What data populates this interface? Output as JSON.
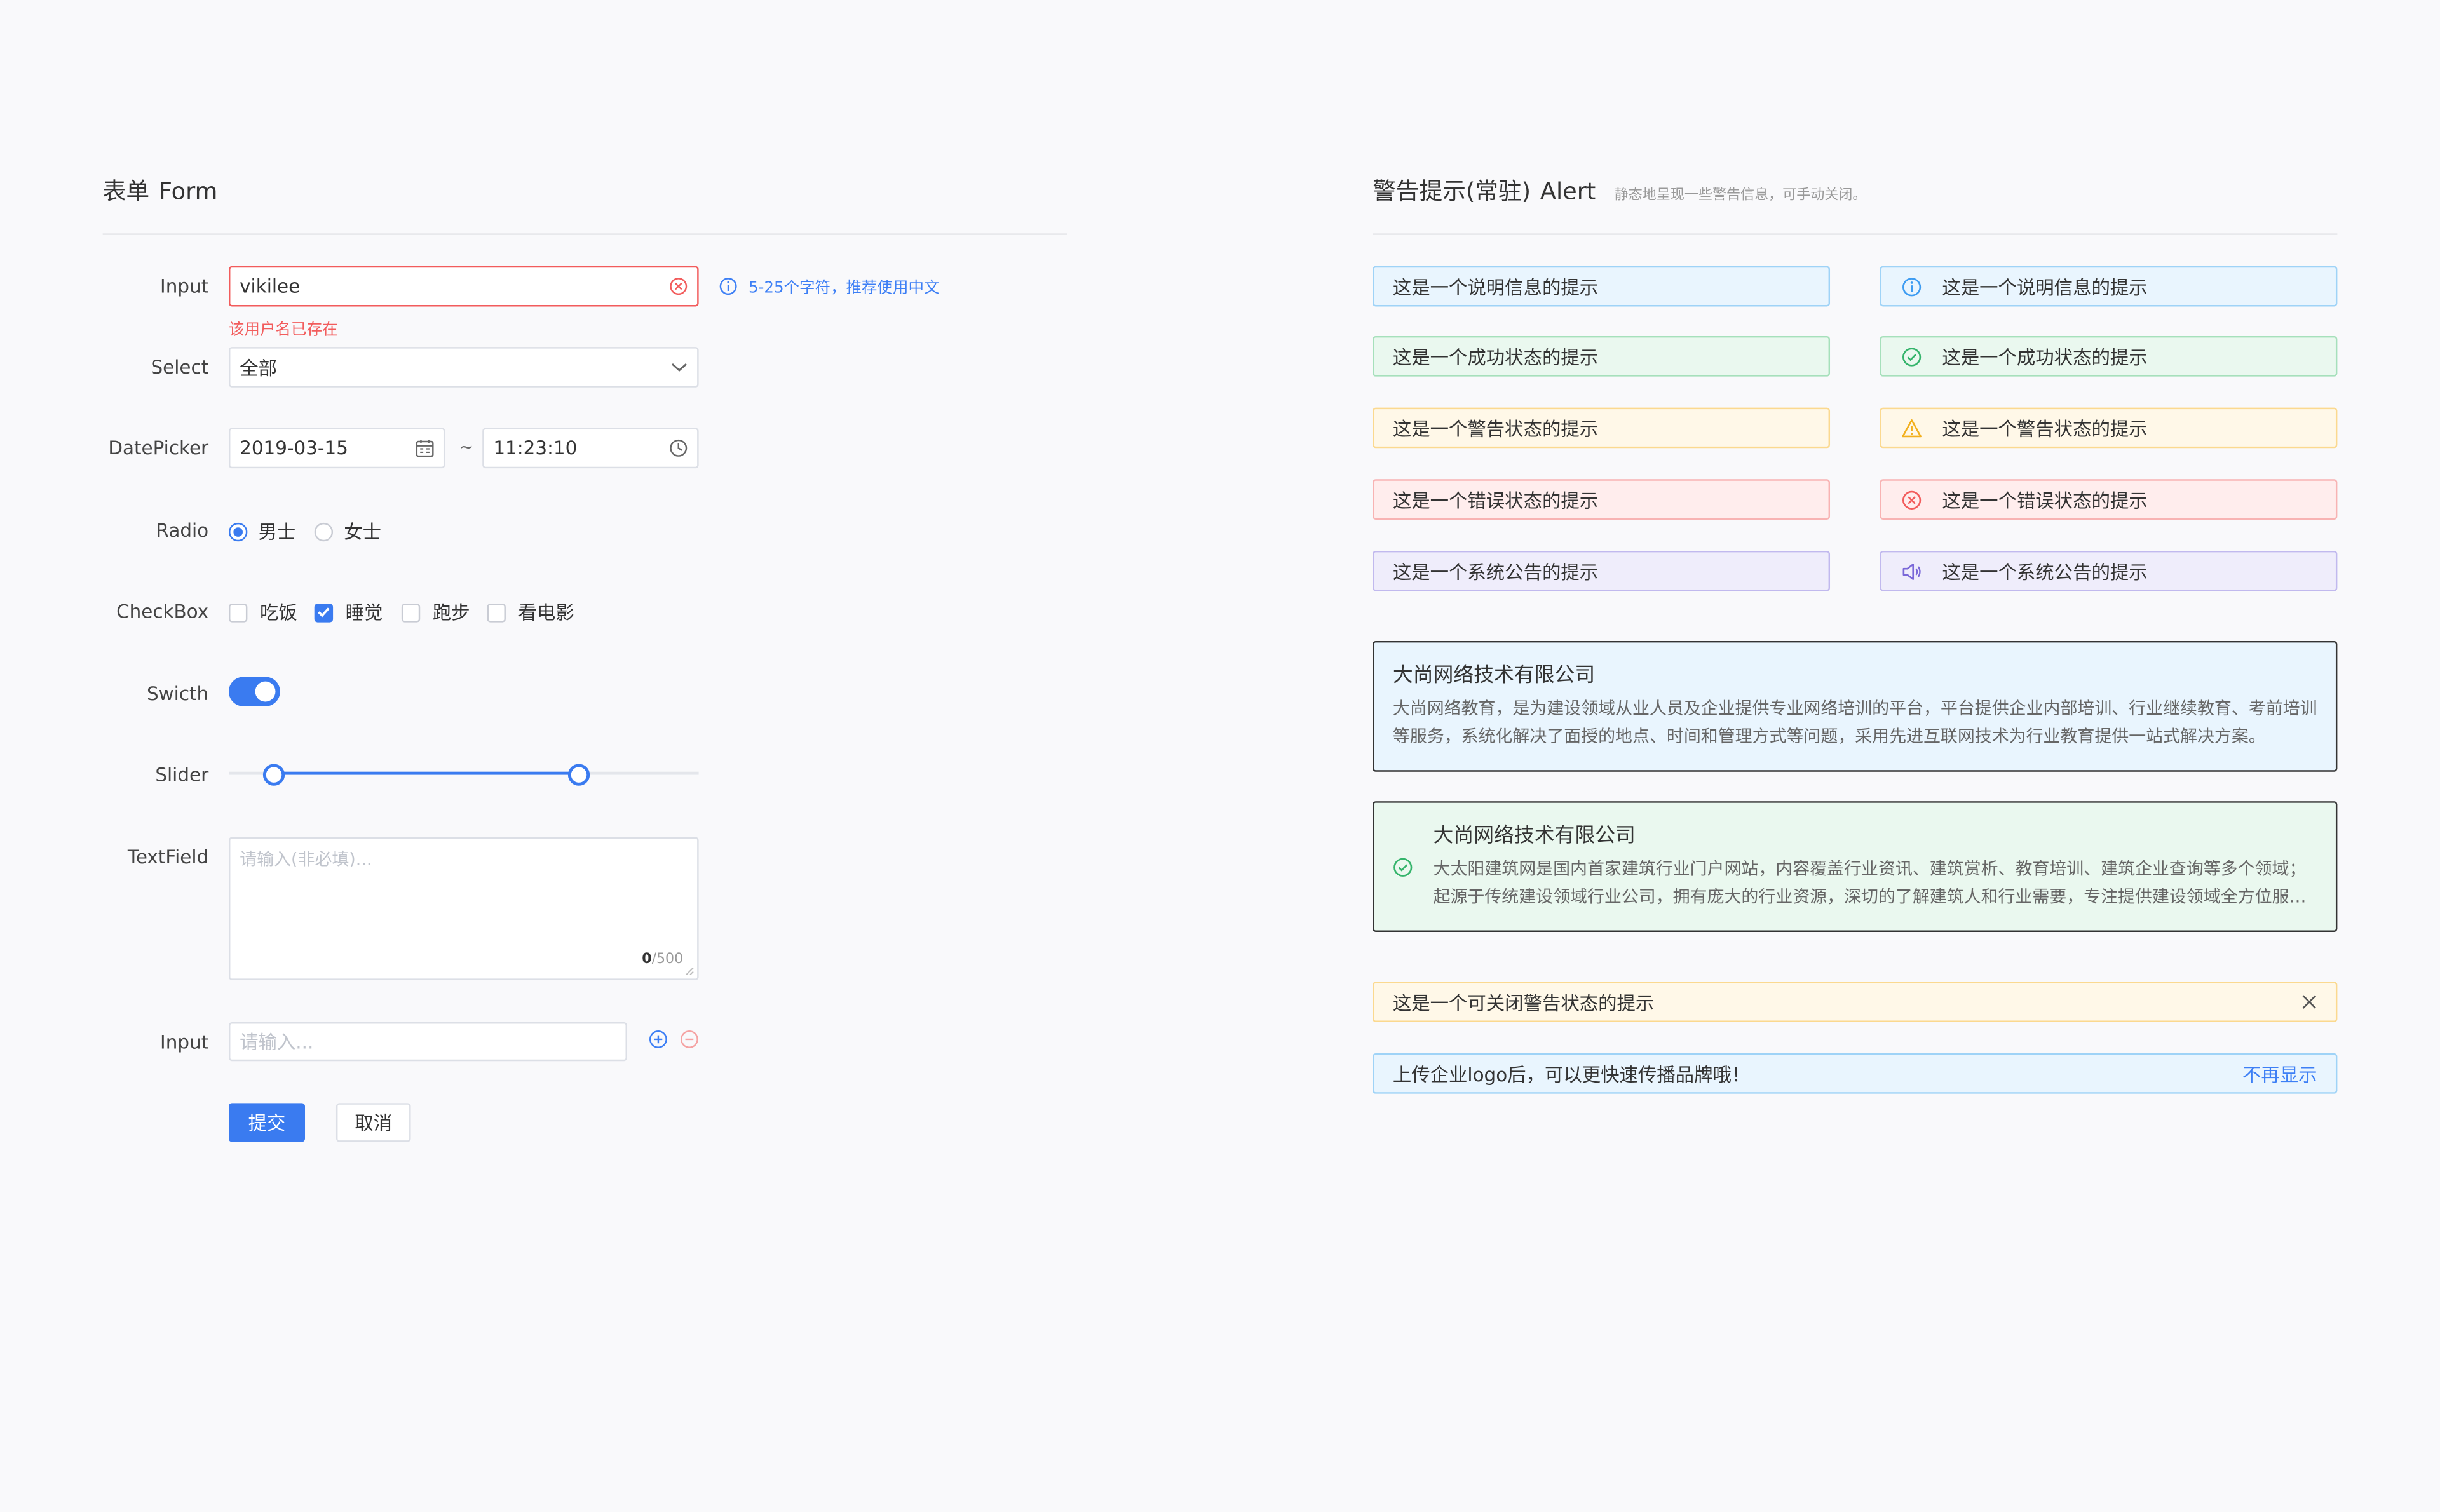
{
  "form": {
    "title": "表单",
    "title_en": "Form",
    "input": {
      "label": "Input",
      "value": "vikilee",
      "error": "该用户名已存在",
      "hint": "5-25个字符，推荐使用中文"
    },
    "select": {
      "label": "Select",
      "value": "全部"
    },
    "datepicker": {
      "label": "DatePicker",
      "date": "2019-03-15",
      "separator": "~",
      "time": "11:23:10"
    },
    "radio": {
      "label": "Radio",
      "options": [
        {
          "text": "男士",
          "checked": true
        },
        {
          "text": "女士",
          "checked": false
        }
      ]
    },
    "checkbox": {
      "label": "CheckBox",
      "options": [
        {
          "text": "吃饭",
          "checked": false
        },
        {
          "text": "睡觉",
          "checked": true
        },
        {
          "text": "跑步",
          "checked": false
        },
        {
          "text": "看电影",
          "checked": false
        }
      ]
    },
    "switch": {
      "label": "Swicth",
      "on": true
    },
    "slider": {
      "label": "Slider",
      "range": [
        0.1,
        0.75
      ]
    },
    "textfield": {
      "label": "TextField",
      "placeholder": "请输入(非必填)...",
      "count": "0",
      "max": "/500"
    },
    "input2": {
      "label": "Input",
      "placeholder": "请输入..."
    },
    "buttons": {
      "submit": "提交",
      "cancel": "取消"
    }
  },
  "alert": {
    "title": "警告提示(常驻)",
    "title_en": "Alert",
    "subtitle": "静态地呈现一些警告信息，可手动关闭。",
    "info": "这是一个说明信息的提示",
    "success": "这是一个成功状态的提示",
    "warning": "这是一个警告状态的提示",
    "error": "这是一个错误状态的提示",
    "notice": "这是一个系统公告的提示",
    "big_info": {
      "title": "大尚网络技术有限公司",
      "desc": "大尚网络教育，是为建设领域从业人员及企业提供专业网络培训的平台，平台提供企业内部培训、行业继续教育、考前培训等服务，系统化解决了面授的地点、时间和管理方式等问题，采用先进互联网技术为行业教育提供一站式解决方案。"
    },
    "big_success": {
      "title": "大尚网络技术有限公司",
      "desc": "大太阳建筑网是国内首家建筑行业门户网站，内容覆盖行业资讯、建筑赏析、教育培训、建筑企业查询等多个领域；起源于传统建设领域行业公司，拥有庞大的行业资源，深切的了解建筑人和行业需要，专注提供建设领域全方位服务。"
    },
    "closable": "这是一个可关闭警告状态的提示",
    "banner": {
      "text": "上传企业logo后，可以更快速传播品牌哦！",
      "action": "不再显示"
    }
  },
  "colors": {
    "primary": "#3a7bf0",
    "error": "#f25c5c",
    "info": "#3d9cf2",
    "success": "#34b46b",
    "warning": "#f2b01e",
    "notice": "#7a68d8"
  }
}
